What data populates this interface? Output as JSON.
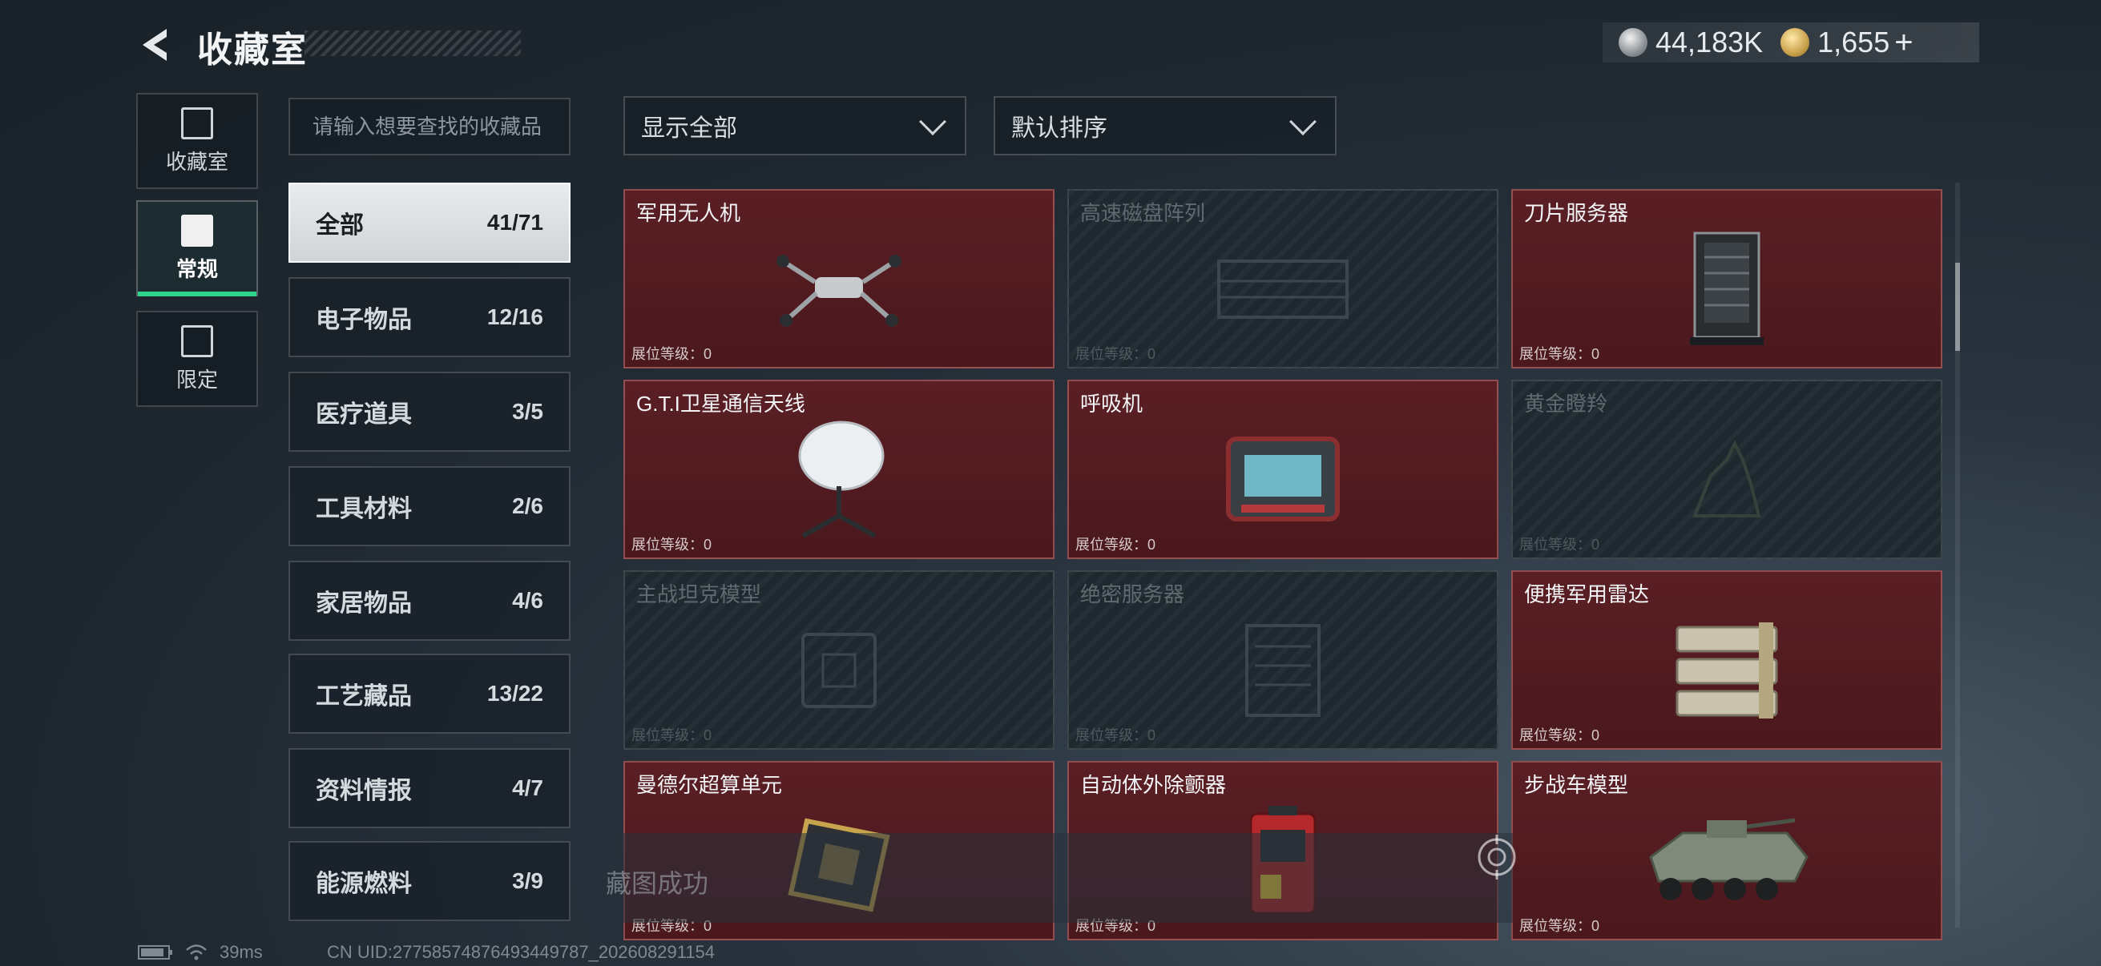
{
  "header": {
    "title": "收藏室",
    "currency": [
      {
        "icon": "silver-coin-icon",
        "value": "44,183K"
      },
      {
        "icon": "gold-coin-icon",
        "value": "1,655"
      }
    ],
    "add_label": "+"
  },
  "nav": [
    {
      "label": "收藏室",
      "icon": "collection-room-icon",
      "active": false
    },
    {
      "label": "常规",
      "icon": "regular-icon",
      "active": true
    },
    {
      "label": "限定",
      "icon": "limited-icon",
      "active": false
    }
  ],
  "search": {
    "placeholder": "请输入想要查找的收藏品"
  },
  "filters": {
    "display": "显示全部",
    "sort": "默认排序"
  },
  "categories": [
    {
      "label": "全部",
      "count": "41/71",
      "active": true
    },
    {
      "label": "电子物品",
      "count": "12/16"
    },
    {
      "label": "医疗道具",
      "count": "3/5"
    },
    {
      "label": "工具材料",
      "count": "2/6"
    },
    {
      "label": "家居物品",
      "count": "4/6"
    },
    {
      "label": "工艺藏品",
      "count": "13/22"
    },
    {
      "label": "资料情报",
      "count": "4/7"
    },
    {
      "label": "能源燃料",
      "count": "3/9"
    }
  ],
  "items": [
    {
      "name": "军用无人机",
      "level": "展位等级：0",
      "owned": true,
      "icon": "drone-icon"
    },
    {
      "name": "高速磁盘阵列",
      "level": "展位等级：0",
      "owned": false,
      "icon": "disk-array-icon"
    },
    {
      "name": "刀片服务器",
      "level": "展位等级：0",
      "owned": true,
      "icon": "blade-server-icon"
    },
    {
      "name": "G.T.I卫星通信天线",
      "level": "展位等级：0",
      "owned": true,
      "icon": "satellite-dish-icon"
    },
    {
      "name": "呼吸机",
      "level": "展位等级：0",
      "owned": true,
      "icon": "ventilator-icon"
    },
    {
      "name": "黄金瞪羚",
      "level": "展位等级：0",
      "owned": false,
      "icon": "gold-gazelle-icon"
    },
    {
      "name": "主战坦克模型",
      "level": "展位等级：0",
      "owned": false,
      "icon": "tank-model-icon"
    },
    {
      "name": "绝密服务器",
      "level": "展位等级：0",
      "owned": false,
      "icon": "secret-server-icon"
    },
    {
      "name": "便携军用雷达",
      "level": "展位等级：0",
      "owned": true,
      "icon": "radar-icon"
    },
    {
      "name": "曼德尔超算单元",
      "level": "展位等级：0",
      "owned": true,
      "icon": "supercomputer-unit-icon"
    },
    {
      "name": "自动体外除颤器",
      "level": "展位等级：0",
      "owned": true,
      "icon": "defibrillator-icon"
    },
    {
      "name": "步战车模型",
      "level": "展位等级：0",
      "owned": true,
      "icon": "ifv-model-icon"
    }
  ],
  "toast": {
    "text": "藏图成功"
  },
  "footer": {
    "ping": "39ms",
    "uid": "CN UID:27758574876493449787_202608291154"
  }
}
